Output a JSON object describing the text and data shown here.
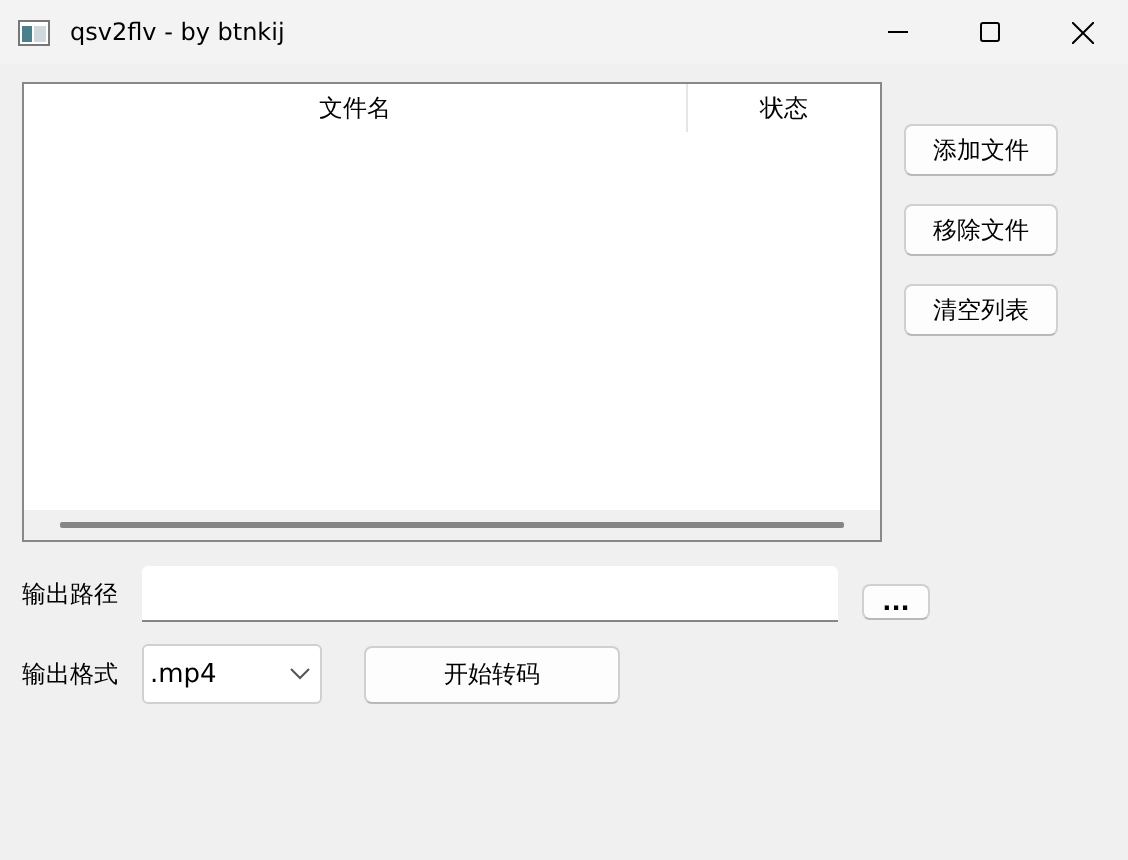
{
  "window": {
    "title": "qsv2flv - by btnkij"
  },
  "table": {
    "columns": [
      "文件名",
      "状态"
    ]
  },
  "side_buttons": [
    "添加文件",
    "移除文件",
    "清空列表"
  ],
  "output_path": {
    "label": "输出路径",
    "browse_button": "..."
  },
  "output_format": {
    "label": "输出格式",
    "value": ".mp4",
    "start_button": "开始转码"
  }
}
